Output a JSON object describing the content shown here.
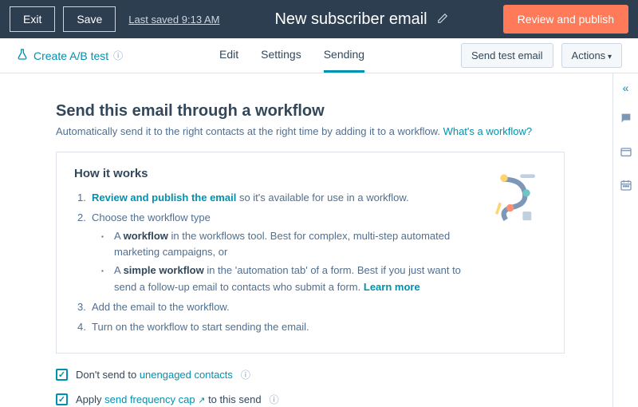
{
  "header": {
    "exit": "Exit",
    "save": "Save",
    "last_saved": "Last saved 9:13 AM",
    "title": "New subscriber email",
    "review_publish": "Review and publish"
  },
  "subbar": {
    "ab_test": "Create A/B test",
    "tabs": {
      "edit": "Edit",
      "settings": "Settings",
      "sending": "Sending"
    },
    "send_test": "Send test email",
    "actions": "Actions"
  },
  "main": {
    "heading": "Send this email through a workflow",
    "subtitle_prefix": "Automatically send it to the right contacts at the right time by adding it to a workflow. ",
    "subtitle_link": "What's a workflow?",
    "how": {
      "title": "How it works",
      "step1_link": "Review and publish the email",
      "step1_rest": " so it's available for use in a workflow.",
      "step2": "Choose the workflow type",
      "step2a_pre": "A ",
      "step2a_bold": "workflow",
      "step2a_rest": " in the workflows tool. Best for complex, multi-step automated marketing campaigns, or",
      "step2b_pre": "A ",
      "step2b_bold": "simple workflow",
      "step2b_rest": " in the 'automation tab' of a form. Best if you just want to send a follow-up email to contacts who submit a form. ",
      "step2b_link": "Learn more",
      "step3": "Add the email to the workflow.",
      "step4": "Turn on the workflow to start sending the email."
    },
    "check1_pre": "Don't send to ",
    "check1_link": "unengaged contacts",
    "check2_pre": "Apply ",
    "check2_link": "send frequency cap",
    "check2_rest": " to this send"
  },
  "icons": {
    "info": "ⓘ",
    "check": "✓",
    "external": "↗"
  }
}
